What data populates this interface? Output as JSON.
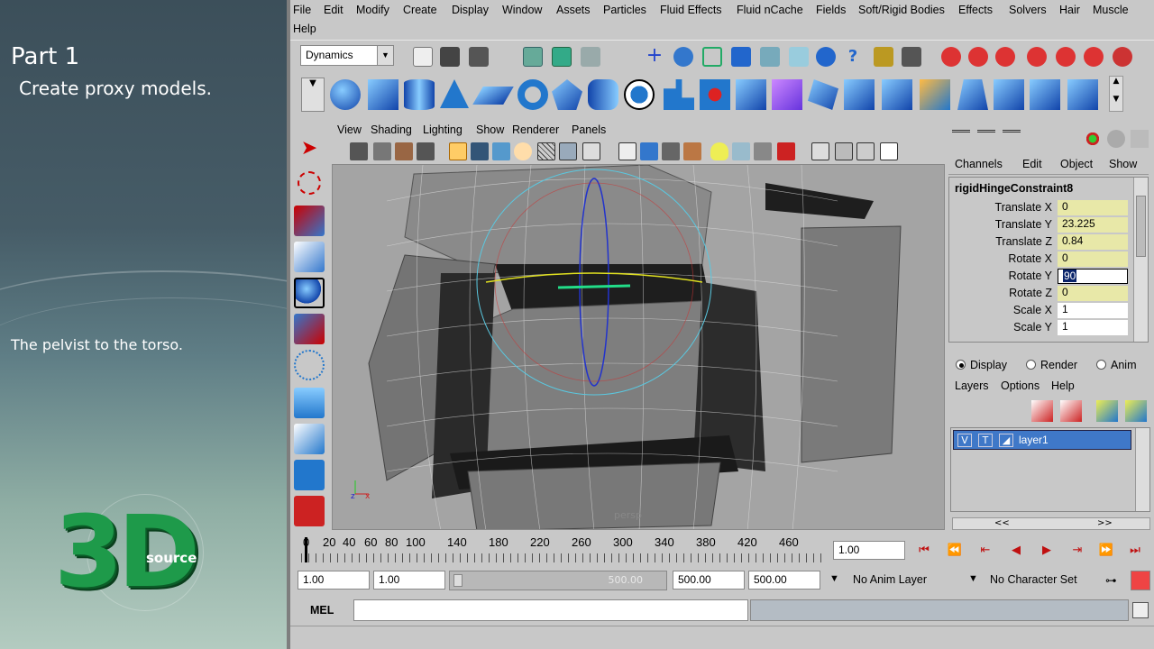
{
  "tutorial": {
    "title": "Part 1",
    "subtitle": "Create proxy models.",
    "step": "The pelvist to the torso.",
    "logo_main": "3D",
    "logo_sub": "source"
  },
  "menubar": {
    "items": [
      "File",
      "Edit",
      "Modify",
      "Create",
      "Display",
      "Window",
      "Assets",
      "Particles",
      "Fluid Effects",
      "Fluid nCache",
      "Fields",
      "Soft/Rigid Bodies",
      "Effects",
      "Solvers",
      "Hair",
      "Muscle"
    ],
    "help": "Help"
  },
  "shelf": {
    "menu_set": "Dynamics"
  },
  "viewport": {
    "menu": [
      "View",
      "Shading",
      "Lighting",
      "Show",
      "Renderer",
      "Panels"
    ],
    "camera_label": "persp"
  },
  "channel_box": {
    "menu": [
      "Channels",
      "Edit",
      "Object",
      "Show"
    ],
    "node_name": "rigidHingeConstraint8",
    "attributes": [
      {
        "label": "Translate X",
        "value": "0"
      },
      {
        "label": "Translate Y",
        "value": "23.225"
      },
      {
        "label": "Translate Z",
        "value": "0.84"
      },
      {
        "label": "Rotate X",
        "value": "0"
      },
      {
        "label": "Rotate Y",
        "value": "90"
      },
      {
        "label": "Rotate Z",
        "value": "0"
      },
      {
        "label": "Scale X",
        "value": "1"
      },
      {
        "label": "Scale Y",
        "value": "1"
      }
    ]
  },
  "layer_editor": {
    "modes": [
      "Display",
      "Render",
      "Anim"
    ],
    "selected_mode": "Display",
    "menu": [
      "Layers",
      "Options",
      "Help"
    ],
    "layer": {
      "visible": "V",
      "type": "T",
      "name": "layer1"
    },
    "nav_left": "<<",
    "nav_right": ">>"
  },
  "time_slider": {
    "ticks": [
      "0",
      "20",
      "40",
      "60",
      "80",
      "100",
      "140",
      "180",
      "220",
      "260",
      "300",
      "340",
      "380",
      "420",
      "460"
    ],
    "current_frame": "1.00"
  },
  "range_slider": {
    "start_time": "1.00",
    "playback_start": "1.00",
    "bar_label": "500.00",
    "playback_end": "500.00",
    "end_time": "500.00",
    "anim_layer": "No Anim Layer",
    "character_set": "No Character Set"
  },
  "command_line": {
    "label": "MEL"
  },
  "colors": {
    "accent_blue": "#3f78c8",
    "locked_yellow": "#e8e8a8",
    "logo_green": "#1e9a4a"
  }
}
